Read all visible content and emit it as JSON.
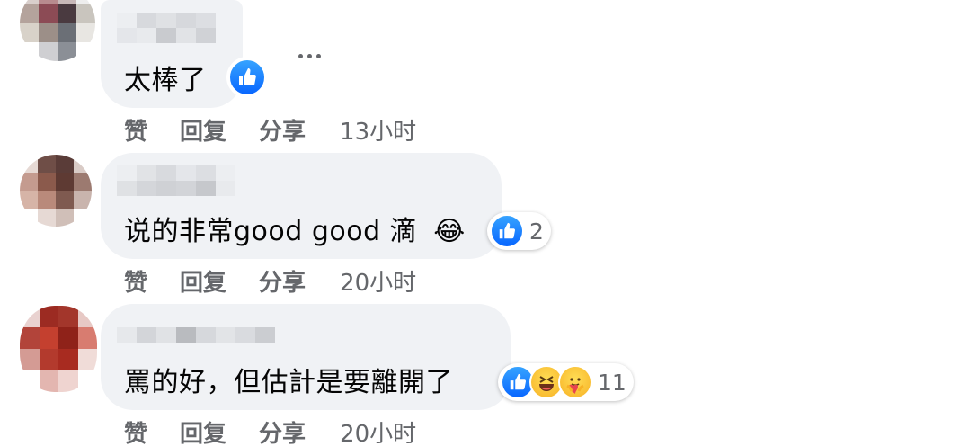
{
  "colors": {
    "bubble_bg": "#f0f2f5",
    "like_blue": "#0866ff",
    "meta_gray": "#65676b",
    "text": "#050505"
  },
  "comments": [
    {
      "text": "太棒了",
      "reactions": [
        "like-icon"
      ],
      "reaction_count": "",
      "actions": {
        "like": "赞",
        "reply": "回复",
        "share": "分享"
      },
      "time": "13小时"
    },
    {
      "text": "说的非常good good 滴",
      "emoji": "😂",
      "reactions": [
        "like-icon"
      ],
      "reaction_count": "2",
      "actions": {
        "like": "赞",
        "reply": "回复",
        "share": "分享"
      },
      "time": "20小时"
    },
    {
      "text": "罵的好，但估計是要離開了",
      "reactions": [
        "like-icon",
        "haha-icon",
        "care-icon"
      ],
      "reaction_count": "11",
      "actions": {
        "like": "赞",
        "reply": "回复",
        "share": "分享"
      },
      "time": "20小时"
    }
  ]
}
